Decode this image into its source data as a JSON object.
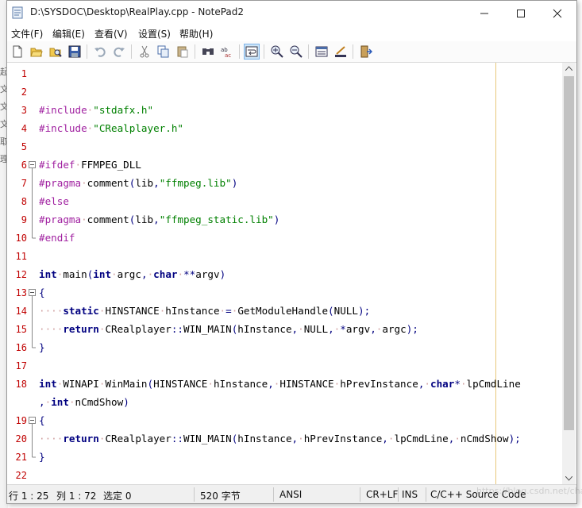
{
  "window": {
    "title": "D:\\SYSDOC\\Desktop\\RealPlay.cpp - NotePad2"
  },
  "background_chars": [
    "起",
    "文",
    "文",
    "文",
    "取",
    "理"
  ],
  "menu": [
    {
      "label": "文件(F)"
    },
    {
      "label": "编辑(E)"
    },
    {
      "label": "查看(V)"
    },
    {
      "label": "设置(S)"
    },
    {
      "label": "帮助(H)"
    }
  ],
  "toolbar": {
    "icons": [
      "new-icon",
      "open-icon",
      "browse-icon",
      "save-icon",
      "undo-icon",
      "redo-icon",
      "cut-icon",
      "copy-icon",
      "paste-icon",
      "find-icon",
      "replace-icon",
      "word-wrap-icon",
      "zoom-in-icon",
      "zoom-out-icon",
      "view-scheme-icon",
      "customize-scheme-icon",
      "exit-icon"
    ]
  },
  "editor": {
    "lines": [
      {
        "n": "1",
        "tokens": []
      },
      {
        "n": "2",
        "tokens": []
      },
      {
        "n": "3",
        "tokens": [
          [
            "pp",
            "#include"
          ],
          [
            "ws",
            "·"
          ],
          [
            "str",
            "\"stdafx.h\""
          ]
        ]
      },
      {
        "n": "4",
        "tokens": [
          [
            "pp",
            "#include"
          ],
          [
            "ws",
            "·"
          ],
          [
            "str",
            "\"CRealplayer.h\""
          ]
        ]
      },
      {
        "n": "5",
        "tokens": []
      },
      {
        "n": "6",
        "tokens": [
          [
            "pp",
            "#ifdef"
          ],
          [
            "ws",
            "·"
          ],
          [
            "plain",
            "FFMPEG_DLL"
          ]
        ],
        "fold": "open"
      },
      {
        "n": "7",
        "tokens": [
          [
            "pp",
            "#pragma"
          ],
          [
            "ws",
            "·"
          ],
          [
            "plain",
            "comment"
          ],
          [
            "op",
            "("
          ],
          [
            "plain",
            "lib"
          ],
          [
            "op",
            ","
          ],
          [
            "str",
            "\"ffmpeg.lib\""
          ],
          [
            "op",
            ")"
          ]
        ],
        "fold": "line"
      },
      {
        "n": "8",
        "tokens": [
          [
            "pp",
            "#else"
          ]
        ],
        "fold": "line"
      },
      {
        "n": "9",
        "tokens": [
          [
            "pp",
            "#pragma"
          ],
          [
            "ws",
            "·"
          ],
          [
            "plain",
            "comment"
          ],
          [
            "op",
            "("
          ],
          [
            "plain",
            "lib"
          ],
          [
            "op",
            ","
          ],
          [
            "str",
            "\"ffmpeg_static.lib\""
          ],
          [
            "op",
            ")"
          ]
        ],
        "fold": "line"
      },
      {
        "n": "10",
        "tokens": [
          [
            "pp",
            "#endif"
          ]
        ],
        "fold": "end"
      },
      {
        "n": "11",
        "tokens": []
      },
      {
        "n": "12",
        "tokens": [
          [
            "kw",
            "int"
          ],
          [
            "ws",
            "·"
          ],
          [
            "plain",
            "main"
          ],
          [
            "op",
            "("
          ],
          [
            "kw",
            "int"
          ],
          [
            "ws",
            "·"
          ],
          [
            "plain",
            "argc"
          ],
          [
            "op",
            ","
          ],
          [
            "ws",
            "·"
          ],
          [
            "kw",
            "char"
          ],
          [
            "ws",
            "·"
          ],
          [
            "op",
            "**"
          ],
          [
            "plain",
            "argv"
          ],
          [
            "op",
            ")"
          ]
        ]
      },
      {
        "n": "13",
        "tokens": [
          [
            "op",
            "{"
          ]
        ],
        "fold": "open"
      },
      {
        "n": "14",
        "tokens": [
          [
            "ws",
            "····"
          ],
          [
            "kw",
            "static"
          ],
          [
            "ws",
            "·"
          ],
          [
            "plain",
            "HINSTANCE"
          ],
          [
            "ws",
            "·"
          ],
          [
            "plain",
            "hInstance"
          ],
          [
            "ws",
            "·"
          ],
          [
            "op",
            "="
          ],
          [
            "ws",
            "·"
          ],
          [
            "plain",
            "GetModuleHandle"
          ],
          [
            "op",
            "("
          ],
          [
            "plain",
            "NULL"
          ],
          [
            "op",
            ");"
          ]
        ],
        "fold": "line"
      },
      {
        "n": "15",
        "tokens": [
          [
            "ws",
            "····"
          ],
          [
            "kw",
            "return"
          ],
          [
            "ws",
            "·"
          ],
          [
            "plain",
            "CRealplayer"
          ],
          [
            "op",
            "::"
          ],
          [
            "plain",
            "WIN_MAIN"
          ],
          [
            "op",
            "("
          ],
          [
            "plain",
            "hInstance"
          ],
          [
            "op",
            ","
          ],
          [
            "ws",
            "·"
          ],
          [
            "plain",
            "NULL"
          ],
          [
            "op",
            ","
          ],
          [
            "ws",
            "·"
          ],
          [
            "op",
            "*"
          ],
          [
            "plain",
            "argv"
          ],
          [
            "op",
            ","
          ],
          [
            "ws",
            "·"
          ],
          [
            "plain",
            "argc"
          ],
          [
            "op",
            ");"
          ]
        ],
        "fold": "line"
      },
      {
        "n": "16",
        "tokens": [
          [
            "op",
            "}"
          ]
        ],
        "fold": "end"
      },
      {
        "n": "17",
        "tokens": []
      },
      {
        "n": "18",
        "tokens": [
          [
            "kw",
            "int"
          ],
          [
            "ws",
            "·"
          ],
          [
            "plain",
            "WINAPI"
          ],
          [
            "ws",
            "·"
          ],
          [
            "plain",
            "WinMain"
          ],
          [
            "op",
            "("
          ],
          [
            "plain",
            "HINSTANCE"
          ],
          [
            "ws",
            "·"
          ],
          [
            "plain",
            "hInstance"
          ],
          [
            "op",
            ","
          ],
          [
            "ws",
            "·"
          ],
          [
            "plain",
            "HINSTANCE"
          ],
          [
            "ws",
            "·"
          ],
          [
            "plain",
            "hPrevInstance"
          ],
          [
            "op",
            ","
          ],
          [
            "ws",
            "·"
          ],
          [
            "kw",
            "char"
          ],
          [
            "op",
            "*"
          ],
          [
            "ws",
            "·"
          ],
          [
            "plain",
            "lpCmdLine"
          ]
        ]
      },
      {
        "n": "",
        "tokens": [
          [
            "op",
            ","
          ],
          [
            "ws",
            "·"
          ],
          [
            "kw",
            "int"
          ],
          [
            "ws",
            "·"
          ],
          [
            "plain",
            "nCmdShow"
          ],
          [
            "op",
            ")"
          ]
        ]
      },
      {
        "n": "19",
        "tokens": [
          [
            "op",
            "{"
          ]
        ],
        "fold": "open"
      },
      {
        "n": "20",
        "tokens": [
          [
            "ws",
            "····"
          ],
          [
            "kw",
            "return"
          ],
          [
            "ws",
            "·"
          ],
          [
            "plain",
            "CRealplayer"
          ],
          [
            "op",
            "::"
          ],
          [
            "plain",
            "WIN_MAIN"
          ],
          [
            "op",
            "("
          ],
          [
            "plain",
            "hInstance"
          ],
          [
            "op",
            ","
          ],
          [
            "ws",
            "·"
          ],
          [
            "plain",
            "hPrevInstance"
          ],
          [
            "op",
            ","
          ],
          [
            "ws",
            "·"
          ],
          [
            "plain",
            "lpCmdLine"
          ],
          [
            "op",
            ","
          ],
          [
            "ws",
            "·"
          ],
          [
            "plain",
            "nCmdShow"
          ],
          [
            "op",
            ");"
          ]
        ],
        "fold": "line"
      },
      {
        "n": "21",
        "tokens": [
          [
            "op",
            "}"
          ]
        ],
        "fold": "end"
      },
      {
        "n": "22",
        "tokens": []
      }
    ]
  },
  "status": {
    "position": "行 1 : 25",
    "column": "列 1 : 72",
    "selection": "选定 0",
    "size": "520 字节",
    "encoding": "ANSI",
    "line_endings": "CR+LF",
    "mode": "INS",
    "scheme": "C/C++ Source Code"
  },
  "watermark": "https://blog.csdn.net/chamigua"
}
